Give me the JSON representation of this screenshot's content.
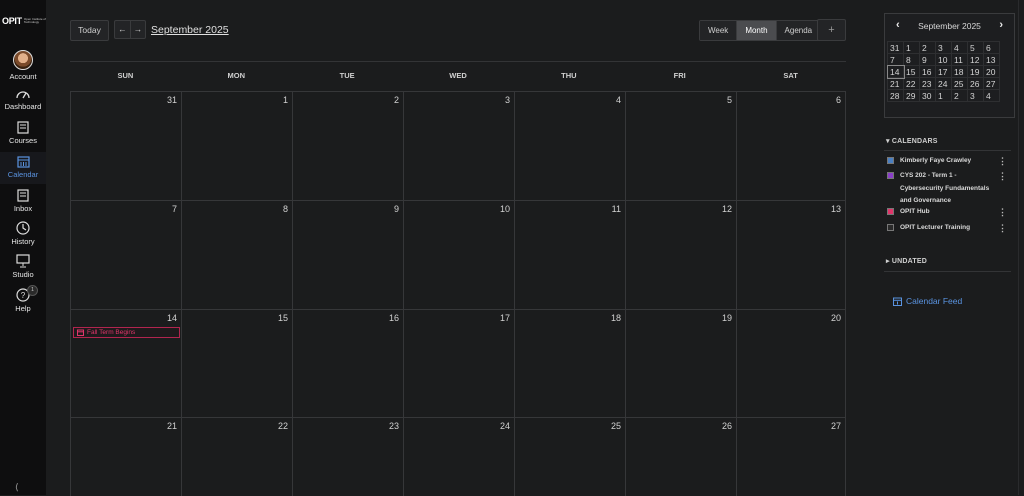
{
  "sidebar": {
    "logo_text": "OPIT",
    "logo_sub": "Open Institute of Technology",
    "items": [
      {
        "label": "Account",
        "icon": "avatar"
      },
      {
        "label": "Dashboard",
        "icon": "dashboard-icon"
      },
      {
        "label": "Courses",
        "icon": "courses-icon"
      },
      {
        "label": "Calendar",
        "icon": "calendar-icon",
        "active": true
      },
      {
        "label": "Inbox",
        "icon": "inbox-icon"
      },
      {
        "label": "History",
        "icon": "history-icon"
      },
      {
        "label": "Studio",
        "icon": "studio-icon"
      },
      {
        "label": "Help",
        "icon": "help-icon",
        "badge": "1"
      }
    ],
    "collapse_glyph": "⟨"
  },
  "toolbar": {
    "today": "Today",
    "prev": "←",
    "next": "→",
    "title": "September 2025",
    "views": [
      "Week",
      "Month",
      "Agenda"
    ],
    "selected_view": "Month",
    "add": "+"
  },
  "calendar": {
    "days_of_week": [
      "SUN",
      "MON",
      "TUE",
      "WED",
      "THU",
      "FRI",
      "SAT"
    ],
    "weeks": [
      [
        "31",
        "1",
        "2",
        "3",
        "4",
        "5",
        "6"
      ],
      [
        "7",
        "8",
        "9",
        "10",
        "11",
        "12",
        "13"
      ],
      [
        "14",
        "15",
        "16",
        "17",
        "18",
        "19",
        "20"
      ],
      [
        "21",
        "22",
        "23",
        "24",
        "25",
        "26",
        "27"
      ]
    ],
    "event": {
      "title": "Fall Term Begins",
      "color": "#e0356a"
    }
  },
  "mini_calendar": {
    "title": "September 2025",
    "prev": "‹",
    "next": "›",
    "today": "14",
    "rows": [
      [
        "31",
        "1",
        "2",
        "3",
        "4",
        "5",
        "6"
      ],
      [
        "7",
        "8",
        "9",
        "10",
        "11",
        "12",
        "13"
      ],
      [
        "14",
        "15",
        "16",
        "17",
        "18",
        "19",
        "20"
      ],
      [
        "21",
        "22",
        "23",
        "24",
        "25",
        "26",
        "27"
      ],
      [
        "28",
        "29",
        "30",
        "1",
        "2",
        "3",
        "4"
      ]
    ]
  },
  "calendars": {
    "header": "CALENDARS",
    "items": [
      {
        "name": "Kimberly Faye Crawley",
        "color": "#4a7fc1"
      },
      {
        "name": "CYS 202 - Term 1 - Cybersecurity Fundamentals and Governance",
        "color": "#8a3fc8"
      },
      {
        "name": "OPIT Hub",
        "color": "#e0356a"
      },
      {
        "name": "OPIT Lecturer Training",
        "color": "#2a2a2a"
      }
    ],
    "menu_glyph": "⋮"
  },
  "undated": {
    "header": "UNDATED"
  },
  "feed": {
    "label": "Calendar Feed"
  },
  "colors": {
    "accent": "#5a93e0",
    "event": "#e0356a",
    "background": "#1b1c1d"
  }
}
